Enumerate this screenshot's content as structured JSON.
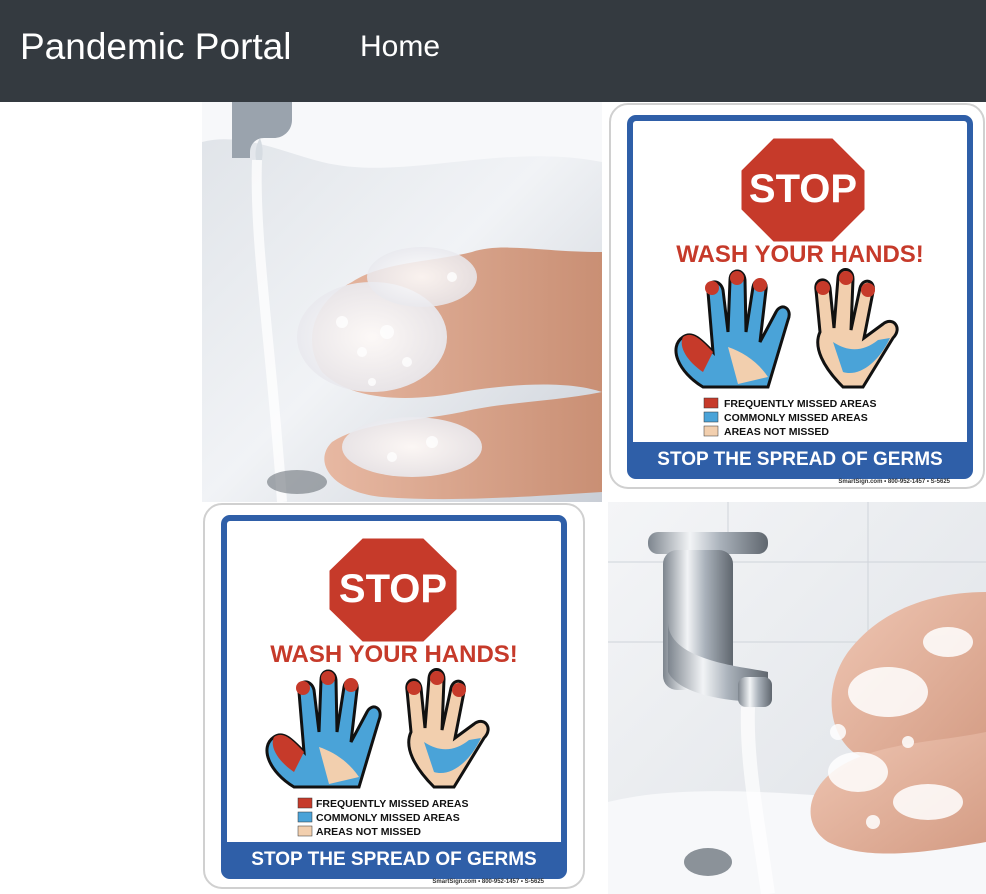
{
  "navbar": {
    "brand": "Pandemic Portal",
    "links": [
      {
        "label": "Home"
      }
    ]
  },
  "gallery": {
    "images": [
      {
        "kind": "photo",
        "subject": "washing-hands-under-faucet"
      },
      {
        "kind": "sign",
        "subject": "stop-wash-hands-sign"
      },
      {
        "kind": "sign",
        "subject": "stop-wash-hands-sign"
      },
      {
        "kind": "photo",
        "subject": "soapy-hands-at-chrome-faucet"
      }
    ],
    "sign": {
      "stop": "STOP",
      "headline": "WASH YOUR HANDS!",
      "legend": [
        {
          "label": "FREQUENTLY MISSED AREAS",
          "color": "#c63a2a"
        },
        {
          "label": "COMMONLY MISSED AREAS",
          "color": "#4aa3d8"
        },
        {
          "label": "AREAS NOT MISSED",
          "color": "#f2cfae"
        }
      ],
      "footer": "STOP THE SPREAD OF GERMS",
      "fineprint": "SmartSign.com • 800-952-1457 • S-5625"
    }
  },
  "colors": {
    "navbar_bg": "#343a40",
    "nav_text": "#ffffff",
    "sign_red": "#c63a2a",
    "sign_blue": "#2f5fa8"
  }
}
